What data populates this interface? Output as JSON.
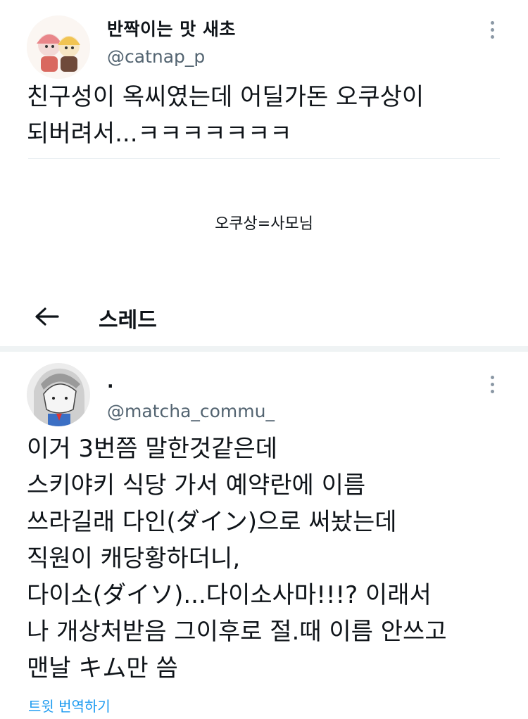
{
  "tweet1": {
    "name": "반짝이는 맛 새초",
    "handle": "@catnap_p",
    "text": "친구성이 옥씨였는데 어딜가돈 오쿠상이\n되버려서...ㅋㅋㅋㅋㅋㅋㅋ"
  },
  "caption": "오쿠상=사모님",
  "thread": {
    "title": "스레드"
  },
  "tweet2": {
    "name": ".",
    "handle": "@matcha_commu_",
    "text": "이거 3번쯤 말한것같은데\n스키야키 식당 가서 예약란에 이름\n쓰라길래 다인(ダイン)으로 써놨는데\n직원이 캐당황하더니,\n다이소(ダイソ)...다이소사마!!!? 이래서\n나 개상처받음 그이후로 절.때 이름 안쓰고\n맨날 キム만 씀",
    "translate": "트윗 번역하기"
  },
  "colors": {
    "link": "#1d9bf0",
    "secondary": "#536471"
  }
}
